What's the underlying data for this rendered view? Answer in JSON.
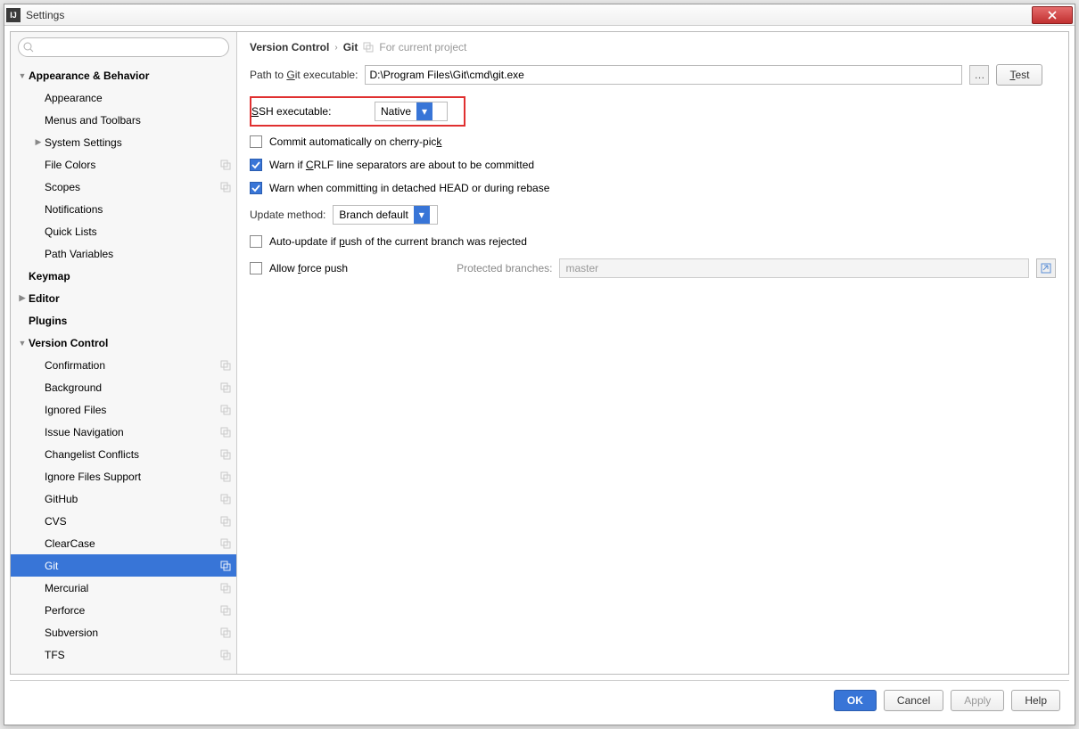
{
  "window": {
    "title": "Settings"
  },
  "search": {
    "placeholder": ""
  },
  "sidebar": {
    "items": [
      {
        "label": "Appearance & Behavior",
        "level": 0,
        "arrow": "down",
        "bold": true
      },
      {
        "label": "Appearance",
        "level": 1
      },
      {
        "label": "Menus and Toolbars",
        "level": 1
      },
      {
        "label": "System Settings",
        "level": 1,
        "arrow": "right"
      },
      {
        "label": "File Colors",
        "level": 1,
        "copy": true
      },
      {
        "label": "Scopes",
        "level": 1,
        "copy": true
      },
      {
        "label": "Notifications",
        "level": 1
      },
      {
        "label": "Quick Lists",
        "level": 1
      },
      {
        "label": "Path Variables",
        "level": 1
      },
      {
        "label": "Keymap",
        "level": 0,
        "bold": true
      },
      {
        "label": "Editor",
        "level": 0,
        "arrow": "right",
        "bold": true
      },
      {
        "label": "Plugins",
        "level": 0,
        "bold": true
      },
      {
        "label": "Version Control",
        "level": 0,
        "arrow": "down",
        "bold": true
      },
      {
        "label": "Confirmation",
        "level": 1,
        "copy": true
      },
      {
        "label": "Background",
        "level": 1,
        "copy": true
      },
      {
        "label": "Ignored Files",
        "level": 1,
        "copy": true
      },
      {
        "label": "Issue Navigation",
        "level": 1,
        "copy": true
      },
      {
        "label": "Changelist Conflicts",
        "level": 1,
        "copy": true
      },
      {
        "label": "Ignore Files Support",
        "level": 1,
        "copy": true
      },
      {
        "label": "GitHub",
        "level": 1,
        "copy": true
      },
      {
        "label": "CVS",
        "level": 1,
        "copy": true
      },
      {
        "label": "ClearCase",
        "level": 1,
        "copy": true
      },
      {
        "label": "Git",
        "level": 1,
        "copy": true,
        "selected": true
      },
      {
        "label": "Mercurial",
        "level": 1,
        "copy": true
      },
      {
        "label": "Perforce",
        "level": 1,
        "copy": true
      },
      {
        "label": "Subversion",
        "level": 1,
        "copy": true
      },
      {
        "label": "TFS",
        "level": 1,
        "copy": true
      }
    ]
  },
  "breadcrumb": {
    "root": "Version Control",
    "leaf": "Git",
    "project_hint": "For current project"
  },
  "form": {
    "path_label_pre": "Path to ",
    "path_label_u": "G",
    "path_label_post": "it executable:",
    "path_value": "D:\\Program Files\\Git\\cmd\\git.exe",
    "test_u": "T",
    "test_post": "est",
    "ssh_u": "S",
    "ssh_post": "SH executable:",
    "ssh_value": "Native",
    "cherry_pre": "Commit automatically on cherry-pic",
    "cherry_u": "k",
    "crlf_pre": "Warn if ",
    "crlf_u": "C",
    "crlf_post": "RLF line separators are about to be committed",
    "detached": "Warn when committing in detached HEAD or during rebase",
    "update_label": "Update method:",
    "update_value": "Branch default",
    "auto_pre": "Auto-update if ",
    "auto_u": "p",
    "auto_post": "ush of the current branch was rejected",
    "force_pre": "Allow ",
    "force_u": "f",
    "force_post": "orce push",
    "protected_label": "Protected branches:",
    "protected_value": "master"
  },
  "footer": {
    "ok": "OK",
    "cancel": "Cancel",
    "apply": "Apply",
    "help": "Help"
  }
}
